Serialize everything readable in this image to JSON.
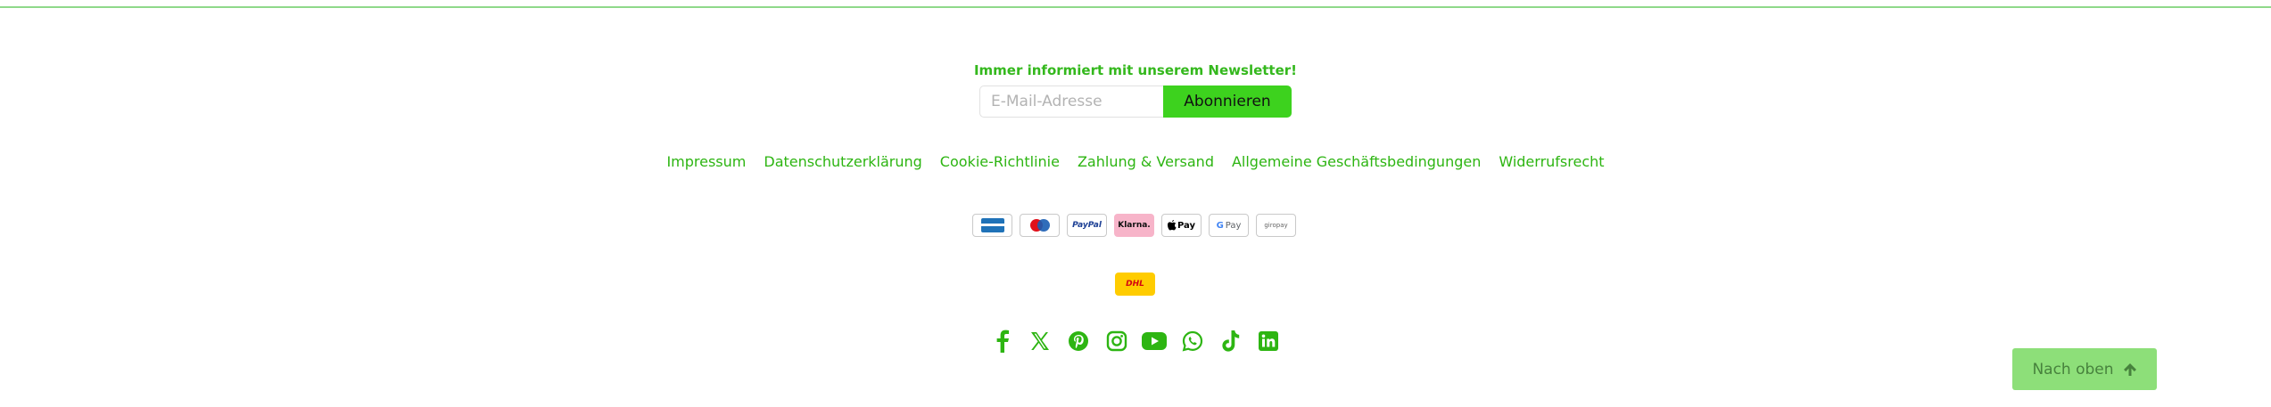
{
  "newsletter": {
    "title": "Immer informiert mit unserem Newsletter!",
    "email_placeholder": "E-Mail-Adresse",
    "subscribe_label": "Abonnieren"
  },
  "footer_links": [
    "Impressum",
    "Datenschutzerklärung",
    "Cookie-Richtlinie",
    "Zahlung & Versand",
    "Allgemeine Geschäftsbedingungen",
    "Widerrufsrecht"
  ],
  "payments": {
    "paypal": "PayPal",
    "klarna": "Klarna.",
    "applepay": "Pay",
    "googlepay": "Pay",
    "giropay": "giropay"
  },
  "shipping": {
    "dhl": "DHL"
  },
  "social_icons": [
    "facebook-icon",
    "x-icon",
    "pinterest-icon",
    "instagram-icon",
    "youtube-icon",
    "whatsapp-icon",
    "tiktok-icon",
    "linkedin-icon"
  ],
  "back_to_top_label": "Nach oben",
  "colors": {
    "accent": "#2db512",
    "button": "#3dd21e",
    "back_to_top_bg": "#8ddf79",
    "rule": "#8fd98a"
  }
}
